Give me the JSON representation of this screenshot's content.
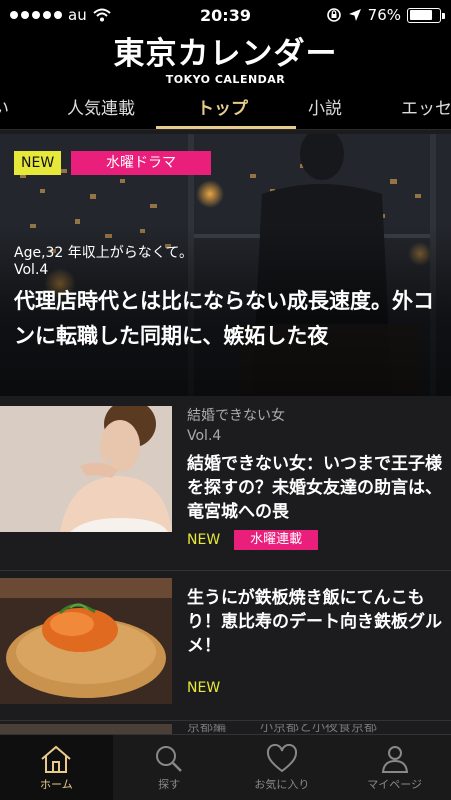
{
  "status_bar": {
    "carrier": "au",
    "time": "20:39",
    "battery": "76%",
    "battery_level": 0.76
  },
  "header": {
    "logo_jp": "東京カレンダー",
    "logo_en": "TOKYO CALENDAR"
  },
  "tabs": [
    {
      "label": "い"
    },
    {
      "label": "人気連載"
    },
    {
      "label": "トップ",
      "active": true
    },
    {
      "label": "小説"
    },
    {
      "label": "エッセ"
    }
  ],
  "hero": {
    "badge_new": "NEW",
    "badge_category": "水曜ドラマ",
    "series": "Age,32 年収上がらなくて。",
    "vol": "Vol.4",
    "title": "代理店時代とは比にならない成長速度。外コンに転職した同期に、嫉妬した夜"
  },
  "articles": [
    {
      "series": "結婚できない女",
      "vol": "Vol.4",
      "title": "結婚できない女：いつまで王子様を探すの？未婚女友達の助言は、竜宮城への畏",
      "tag_new": "NEW",
      "tag_category": "水曜連載"
    },
    {
      "title": "生うにが鉄板焼き飯にてんこもり！恵比寿のデート向き鉄板グルメ！",
      "tag_new": "NEW"
    }
  ],
  "partial_article": {
    "series": "京都編",
    "title": "小京都と小夜食京都"
  },
  "bottom_nav": [
    {
      "label": "ホーム",
      "icon": "home-icon",
      "active": true
    },
    {
      "label": "探す",
      "icon": "search-icon"
    },
    {
      "label": "お気に入り",
      "icon": "heart-icon"
    },
    {
      "label": "マイページ",
      "icon": "person-icon"
    }
  ],
  "colors": {
    "accent_gold": "#e6cb8a",
    "new_yellow": "#e6e83a",
    "pink": "#ea1e7b",
    "background": "#1c1c1e"
  }
}
